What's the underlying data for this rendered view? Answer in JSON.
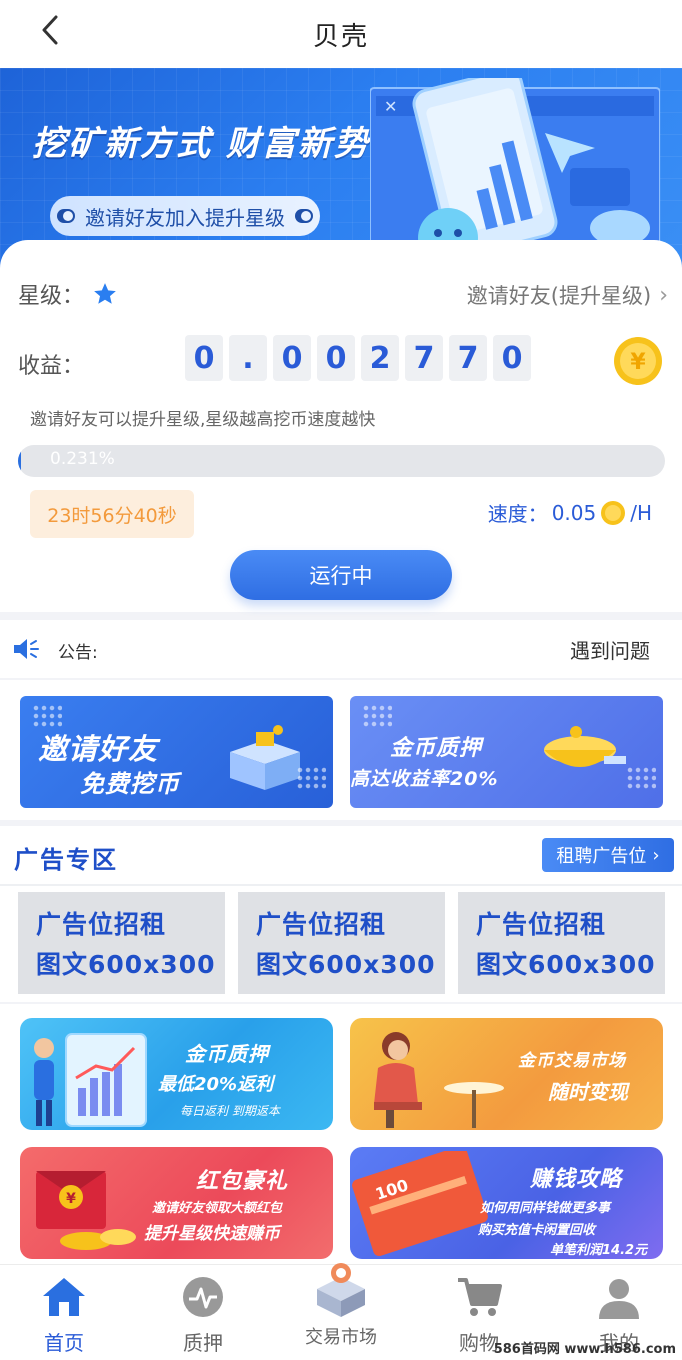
{
  "header": {
    "title": "贝壳"
  },
  "banner": {
    "headline": "挖矿新方式 财富新势力",
    "pill": "邀请好友加入提升星级"
  },
  "mining": {
    "star_label": "星级：",
    "invite_link": "邀请好友(提升星级)",
    "income_label": "收益：",
    "digits": [
      "0",
      ".",
      "0",
      "0",
      "2",
      "7",
      "7",
      "0"
    ],
    "hint": "邀请好友可以提升星级,星级越高挖币速度越快",
    "progress_label": "0.231%",
    "progress_value": 0.00231,
    "timer": "23时56分40秒",
    "speed_label": "速度：",
    "speed_value": "0.05",
    "speed_unit": "/H",
    "run_button": "运行中"
  },
  "notice": {
    "label": "公告:",
    "text": "遇到问题"
  },
  "features": [
    {
      "line1": "邀请好友",
      "line2": "免费挖币"
    },
    {
      "line1": "金币质押",
      "line2": "高达收益率20%"
    }
  ],
  "ads": {
    "title": "广告专区",
    "rent_button": "租聘广告位",
    "boxes": [
      {
        "l1": "广告位招租",
        "l2": "图文600x300"
      },
      {
        "l1": "广告位招租",
        "l2": "图文600x300"
      },
      {
        "l1": "广告位招租",
        "l2": "图文600x300"
      }
    ]
  },
  "promos": [
    {
      "head": "金币质押",
      "sub": "最低20%返利",
      "tag": "每日返利 到期返本"
    },
    {
      "head": "金币交易市场",
      "sub": "随时变现"
    },
    {
      "head": "红包豪礼",
      "tag": "邀请好友领取大额红包",
      "sub": "提升星级快速赚币"
    },
    {
      "head": "赚钱攻略",
      "tag": "如何用同样钱做更多事",
      "sub": "购买充值卡闲置回收",
      "extra": "单笔利润14.2元"
    }
  ],
  "bottom_nav": [
    {
      "label": "首页",
      "icon": "home-icon",
      "active": true
    },
    {
      "label": "质押",
      "icon": "pulse-icon",
      "active": false
    },
    {
      "label": "交易市场",
      "icon": "market-icon",
      "active": false
    },
    {
      "label": "购物",
      "icon": "cart-icon",
      "active": false
    },
    {
      "label": "我的",
      "icon": "user-icon",
      "active": false
    }
  ],
  "watermark": "586首码网 www.h586.com",
  "colors": {
    "primary": "#2a5bd7",
    "accent": "#2f6ee3",
    "timer": "#f39a3c",
    "coin": "#f7c21b"
  }
}
